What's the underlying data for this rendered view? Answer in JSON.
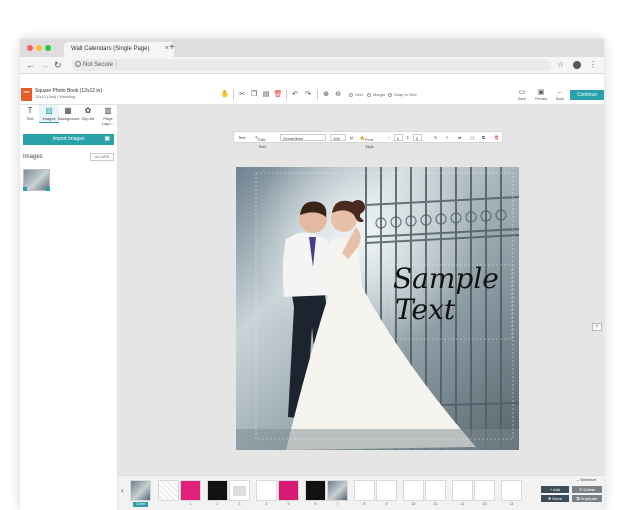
{
  "browser": {
    "tab_title": "Wall Calendars (Single Page)",
    "tab_close": "×",
    "new_tab": "+",
    "security": "Not Secure",
    "colors": {
      "close": "#ff5f57",
      "minimize": "#febc2e",
      "maximize": "#28c840"
    }
  },
  "app": {
    "logo_text": "APP",
    "project_title": "Square Photo Book (12x12 in)",
    "project_subtitle": "12x12 (Jan) | Wedding",
    "options": {
      "grid": "Grid",
      "margin": "Margin",
      "snap": "Snap to Grid"
    },
    "actions": {
      "save": "Save",
      "preview": "Preview",
      "back": "Back",
      "continue": "Continue"
    },
    "accent": "#29a1a8"
  },
  "left_panel": {
    "tabs": [
      "Text",
      "Images",
      "Background",
      "Clip Art",
      "Page Layo..."
    ],
    "active_tab": "Images",
    "import_label": "Import Images",
    "images_label": "Images",
    "albums_label": "ALL/URS"
  },
  "text_toolbar": {
    "label": "Text",
    "edit_text": "Edit Text",
    "font": "GreatVibes",
    "size": "108",
    "unit": "pt",
    "font_style": "Font Style",
    "spacing": "0",
    "line": "0"
  },
  "canvas": {
    "sample_text_line1": "Sample",
    "sample_text_line2": "Text"
  },
  "filmstrip": {
    "cover_label": "Cover",
    "page_numbers": [
      "1",
      "2",
      "3",
      "4",
      "5",
      "6",
      "7",
      "8",
      "9",
      "10",
      "11",
      "12",
      "13",
      "14"
    ],
    "minimize_label": "Minimize",
    "buttons": {
      "add": "Add",
      "delete": "Delete",
      "move": "Move",
      "duplicate": "Duplicate"
    }
  }
}
